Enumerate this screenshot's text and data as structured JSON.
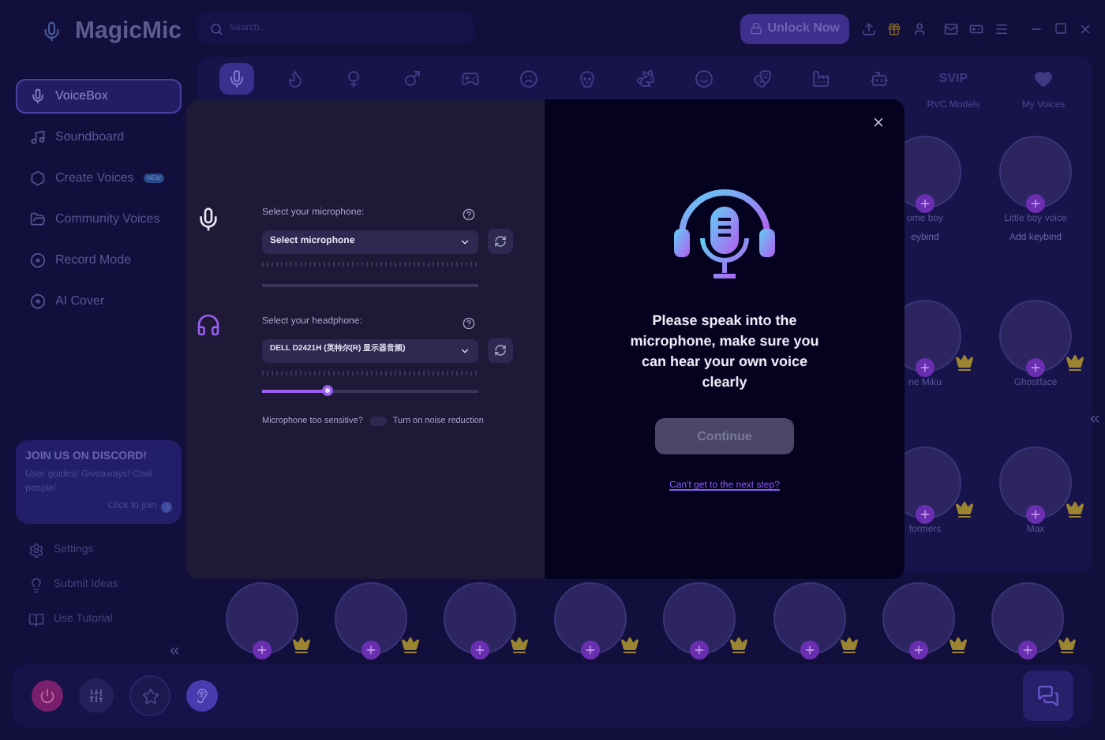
{
  "app": {
    "title": "MagicMic"
  },
  "search": {
    "placeholder": "Search..."
  },
  "unlock_button": "Unlock Now",
  "sidebar": {
    "items": [
      {
        "label": "VoiceBox",
        "selected": true
      },
      {
        "label": "Soundboard",
        "selected": false
      },
      {
        "label": "Create Voices",
        "selected": false,
        "badge": "NEW"
      },
      {
        "label": "Community Voices",
        "selected": false
      },
      {
        "label": "Record Mode",
        "selected": false
      },
      {
        "label": "AI Cover",
        "selected": false
      }
    ],
    "discord": {
      "title": "JOIN US ON DISCORD!",
      "text": "User guides! Giveaways! Cool people!",
      "link": "Click to join"
    },
    "footer_items": [
      {
        "label": "Settings"
      },
      {
        "label": "Submit Ideas"
      },
      {
        "label": "Use Tutorial"
      }
    ]
  },
  "categories": [
    {
      "kind": "icon",
      "selected": true
    },
    {
      "kind": "icon",
      "selected": false
    },
    {
      "kind": "icon",
      "selected": false
    },
    {
      "kind": "icon",
      "selected": false
    },
    {
      "kind": "icon",
      "selected": false
    },
    {
      "kind": "icon",
      "selected": false
    },
    {
      "kind": "icon",
      "selected": false
    },
    {
      "kind": "icon",
      "selected": false
    },
    {
      "kind": "icon",
      "selected": false
    },
    {
      "kind": "icon",
      "selected": false
    },
    {
      "kind": "icon",
      "selected": false
    },
    {
      "kind": "icon",
      "selected": false
    },
    {
      "kind": "text",
      "text": "SVIP",
      "label": "RVC Models",
      "selected": false
    },
    {
      "kind": "icon",
      "label": "My Voices",
      "selected": false
    }
  ],
  "voices": [
    {
      "name": "ome boy",
      "keybind": "eybind"
    },
    {
      "name": "Little boy voice",
      "keybind": "Add keybind"
    },
    {
      "name": "ne Miku",
      "crown": true
    },
    {
      "name": "Ghostface",
      "crown": true
    },
    {
      "name": "formers",
      "crown": true
    },
    {
      "name": "Max",
      "crown": true
    }
  ],
  "bottom_voices": [
    {
      "crown": true
    },
    {
      "crown": true
    },
    {
      "crown": true
    },
    {
      "crown": true
    },
    {
      "crown": true
    },
    {
      "crown": true
    },
    {
      "crown": true
    },
    {
      "crown": true
    }
  ],
  "dialog": {
    "mic_label": "Select your microphone:",
    "mic_value": "Select microphone",
    "headphone_label": "Select your headphone:",
    "headphone_value": "DELL D2421H (英特尔(R) 显示器音频)",
    "volume": {
      "level": 0.3
    },
    "sensitive_text": "Microphone too sensitive?",
    "noise_reduction": {
      "on": false,
      "label": "Turn on noise reduction"
    },
    "message": "Please speak into the microphone, make sure you can hear your own voice clearly",
    "continue": {
      "label": "Continue",
      "disabled": true
    },
    "help_link": "Can't get to the next step?"
  }
}
